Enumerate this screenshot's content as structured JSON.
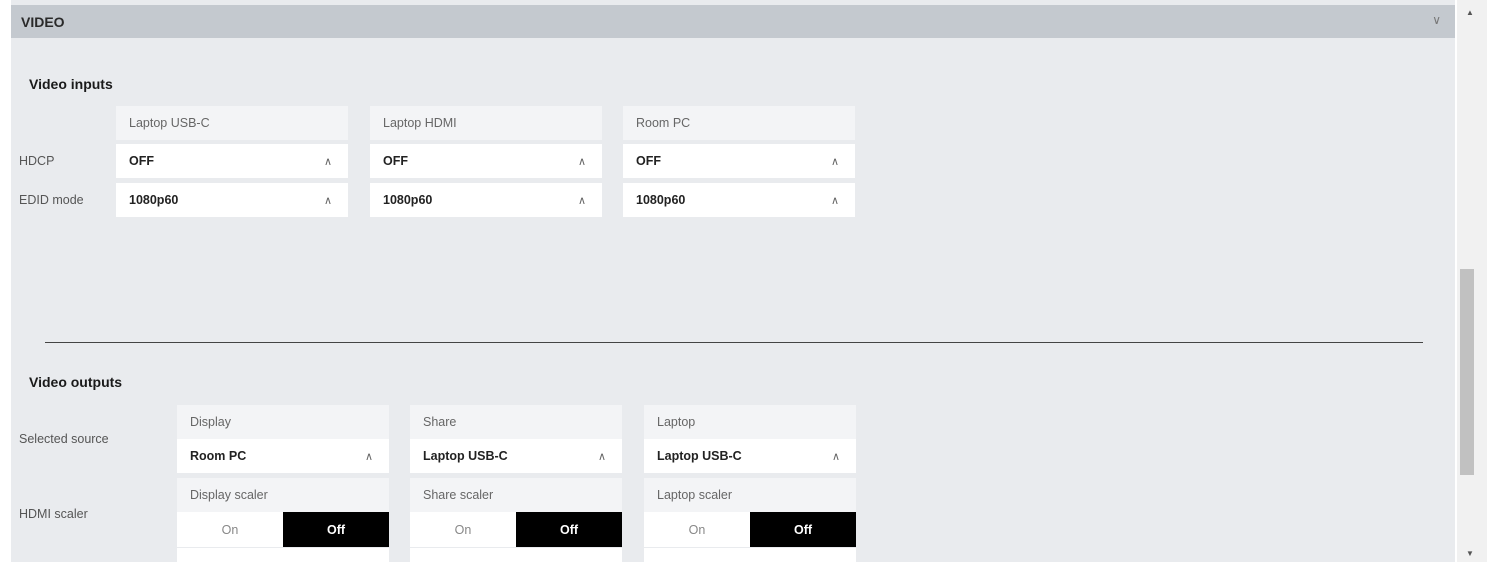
{
  "section": {
    "title": "VIDEO",
    "collapse_icon": "chevron-down-icon",
    "collapse_glyph": "∨"
  },
  "chevron_glyph": "∧",
  "video_inputs": {
    "title": "Video inputs",
    "columns": [
      "Laptop USB-C",
      "Laptop HDMI",
      "Room PC"
    ],
    "rows": [
      {
        "label": "HDCP",
        "values": [
          "OFF",
          "OFF",
          "OFF"
        ]
      },
      {
        "label": "EDID mode",
        "values": [
          "1080p60",
          "1080p60",
          "1080p60"
        ]
      }
    ]
  },
  "video_outputs": {
    "title": "Video outputs",
    "selected_source": {
      "label": "Selected source",
      "outputs": [
        {
          "name": "Display",
          "value": "Room PC"
        },
        {
          "name": "Share",
          "value": "Laptop USB-C"
        },
        {
          "name": "Laptop",
          "value": "Laptop USB-C"
        }
      ]
    },
    "hdmi_scaler": {
      "label": "HDMI scaler",
      "scalers": [
        {
          "name": "Display scaler",
          "on_label": "On",
          "off_label": "Off",
          "selected": "Off"
        },
        {
          "name": "Share scaler",
          "on_label": "On",
          "off_label": "Off",
          "selected": "Off"
        },
        {
          "name": "Laptop scaler",
          "on_label": "On",
          "off_label": "Off",
          "selected": "Off"
        }
      ]
    }
  },
  "scrollbar": {
    "up_glyph": "▲",
    "down_glyph": "▼"
  },
  "colors": {
    "panel_bg": "#e9ebee",
    "header_bg": "#c4c9cf",
    "toggle_selected": "#000000"
  }
}
